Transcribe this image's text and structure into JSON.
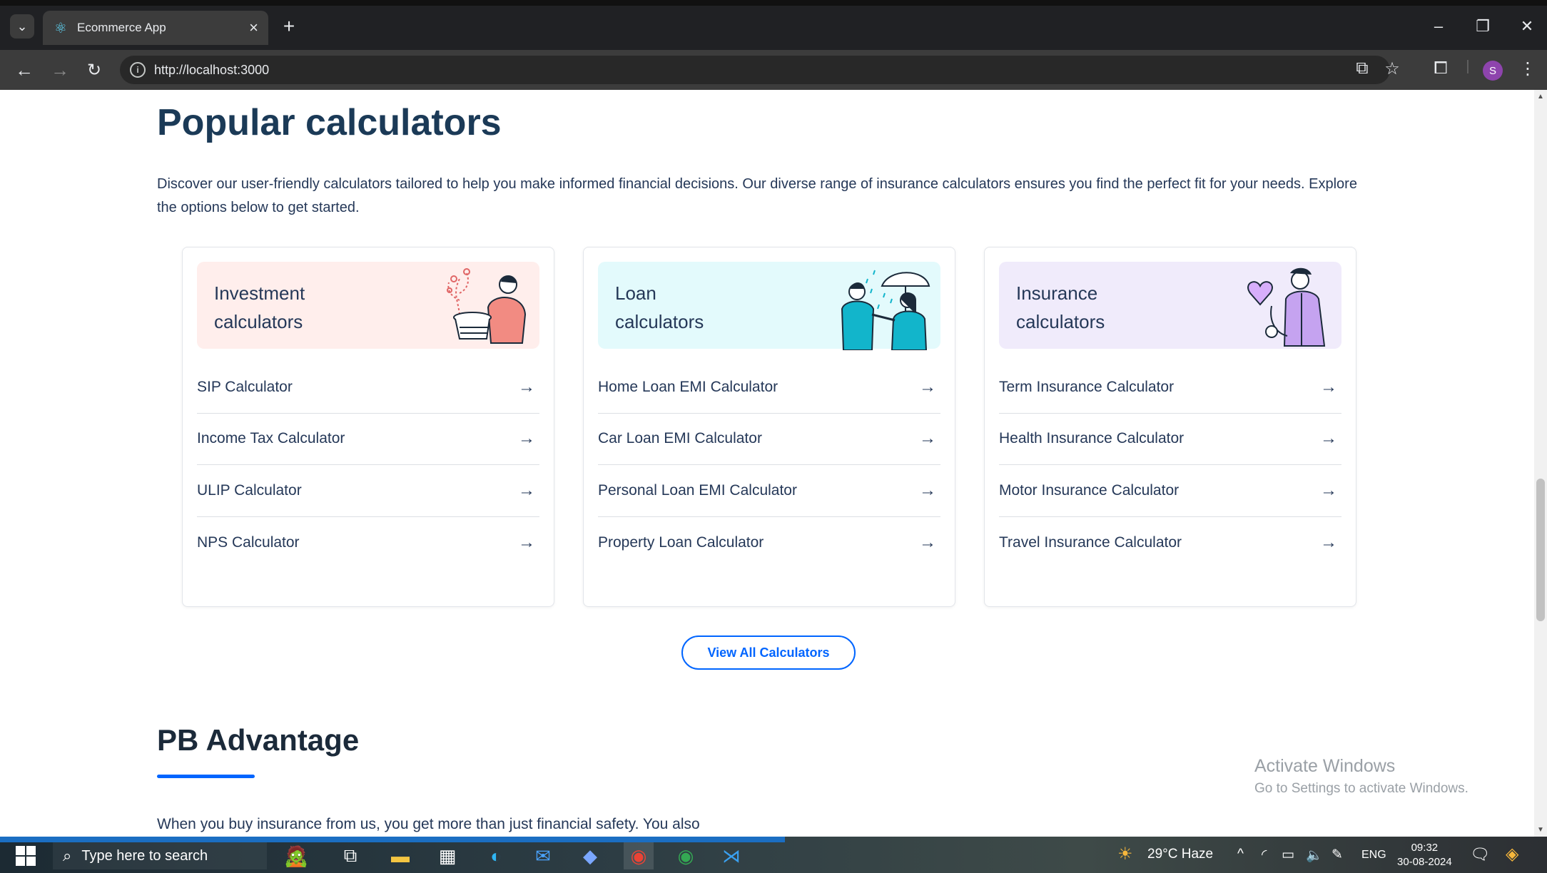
{
  "browser": {
    "tab_title": "Ecommerce App",
    "url": "http://localhost:3000",
    "avatar_letter": "S"
  },
  "page": {
    "section_title": "Popular calculators",
    "section_description": "Discover our user-friendly calculators tailored to help you make informed financial decisions. Our diverse range of insurance calculators ensures you find the perfect fit for your needs. Explore the options below to get started.",
    "cards": [
      {
        "title_line1": "Investment",
        "title_line2": "calculators",
        "color": "#ffeeec",
        "items": [
          "SIP Calculator",
          "Income Tax Calculator",
          "ULIP Calculator",
          "NPS Calculator"
        ]
      },
      {
        "title_line1": "Loan",
        "title_line2": "calculators",
        "color": "#e3fafc",
        "items": [
          "Home Loan EMI Calculator",
          "Car Loan EMI Calculator",
          "Personal Loan EMI Calculator",
          "Property Loan Calculator"
        ]
      },
      {
        "title_line1": "Insurance",
        "title_line2": "calculators",
        "color": "#f0ebfb",
        "items": [
          "Term Insurance Calculator",
          "Health Insurance Calculator",
          "Motor Insurance Calculator",
          "Travel Insurance Calculator"
        ]
      }
    ],
    "view_all_label": "View All Calculators",
    "advantage_title": "PB Advantage",
    "advantage_description": "When you buy insurance from us, you get more than just financial safety. You also",
    "accent_color": "#0065ff"
  },
  "watermark": {
    "line1": "Activate Windows",
    "line2": "Go to Settings to activate Windows."
  },
  "taskbar": {
    "search_placeholder": "Type here to search",
    "weather": "29°C  Haze",
    "language": "ENG",
    "time": "09:32",
    "date": "30-08-2024"
  }
}
